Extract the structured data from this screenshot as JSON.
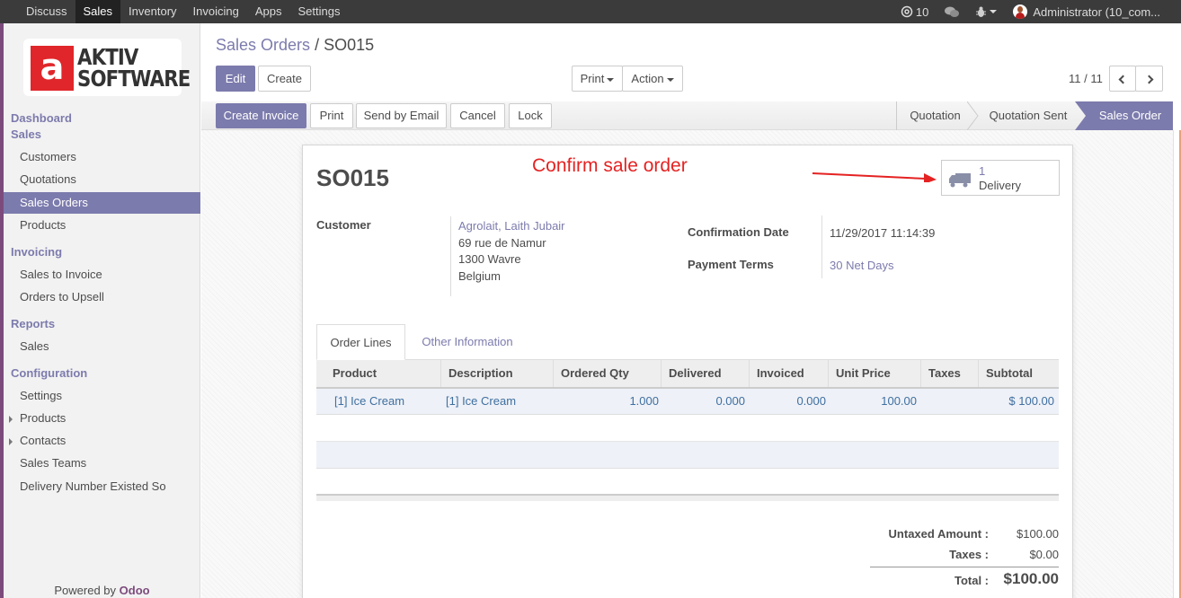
{
  "topbar": {
    "menu": [
      "Discuss",
      "Sales",
      "Inventory",
      "Invoicing",
      "Apps",
      "Settings"
    ],
    "active": "Sales",
    "messages_count": "10",
    "user": "Administrator (10_com..."
  },
  "logo": {
    "letter": "a",
    "line1": "AKTIV",
    "line2": "SOFTWARE"
  },
  "sidebar": {
    "dashboard": "Dashboard",
    "sales_section": "Sales",
    "sales_items": [
      "Customers",
      "Quotations",
      "Sales Orders",
      "Products"
    ],
    "invoicing_section": "Invoicing",
    "invoicing_items": [
      "Sales to Invoice",
      "Orders to Upsell"
    ],
    "reports_section": "Reports",
    "reports_items": [
      "Sales"
    ],
    "config_section": "Configuration",
    "config_items": [
      "Settings",
      "Products",
      "Contacts",
      "Sales Teams",
      "Delivery Number Existed So"
    ],
    "powered_by": "Powered by",
    "powered_brand": "Odoo"
  },
  "breadcrumb": {
    "parent": "Sales Orders",
    "separator": "/",
    "current": "SO015"
  },
  "buttons": {
    "edit": "Edit",
    "create": "Create",
    "print": "Print",
    "action": "Action",
    "pager": "11 / 11"
  },
  "statusbar": {
    "actions": [
      "Create Invoice",
      "Print",
      "Send by Email",
      "Cancel",
      "Lock"
    ],
    "stages": [
      "Quotation",
      "Quotation Sent",
      "Sales Order"
    ],
    "active_stage": "Sales Order"
  },
  "form": {
    "name": "SO015",
    "annotation": "Confirm sale order",
    "delivery_count": "1",
    "delivery_label": "Delivery",
    "customer_label": "Customer",
    "customer_name": "Agrolait, Laith Jubair",
    "address_lines": [
      "69 rue de Namur",
      "1300 Wavre",
      "Belgium"
    ],
    "confirmation_label": "Confirmation Date",
    "confirmation_value": "11/29/2017 11:14:39",
    "payment_terms_label": "Payment Terms",
    "payment_terms_value": "30 Net Days"
  },
  "tabs": [
    "Order Lines",
    "Other Information"
  ],
  "table": {
    "columns": [
      "Product",
      "Description",
      "Ordered Qty",
      "Delivered",
      "Invoiced",
      "Unit Price",
      "Taxes",
      "Subtotal"
    ],
    "rows": [
      [
        "[1] Ice Cream",
        "[1] Ice Cream",
        "1.000",
        "0.000",
        "0.000",
        "100.00",
        "",
        "$ 100.00"
      ]
    ]
  },
  "totals": {
    "untaxed_label": "Untaxed Amount :",
    "untaxed_value": "$100.00",
    "taxes_label": "Taxes :",
    "taxes_value": "$0.00",
    "total_label": "Total :",
    "total_value": "$100.00"
  },
  "colors": {
    "accent": "#7c7bad",
    "brand": "#7c4b7c",
    "annotation": "#e52222"
  }
}
